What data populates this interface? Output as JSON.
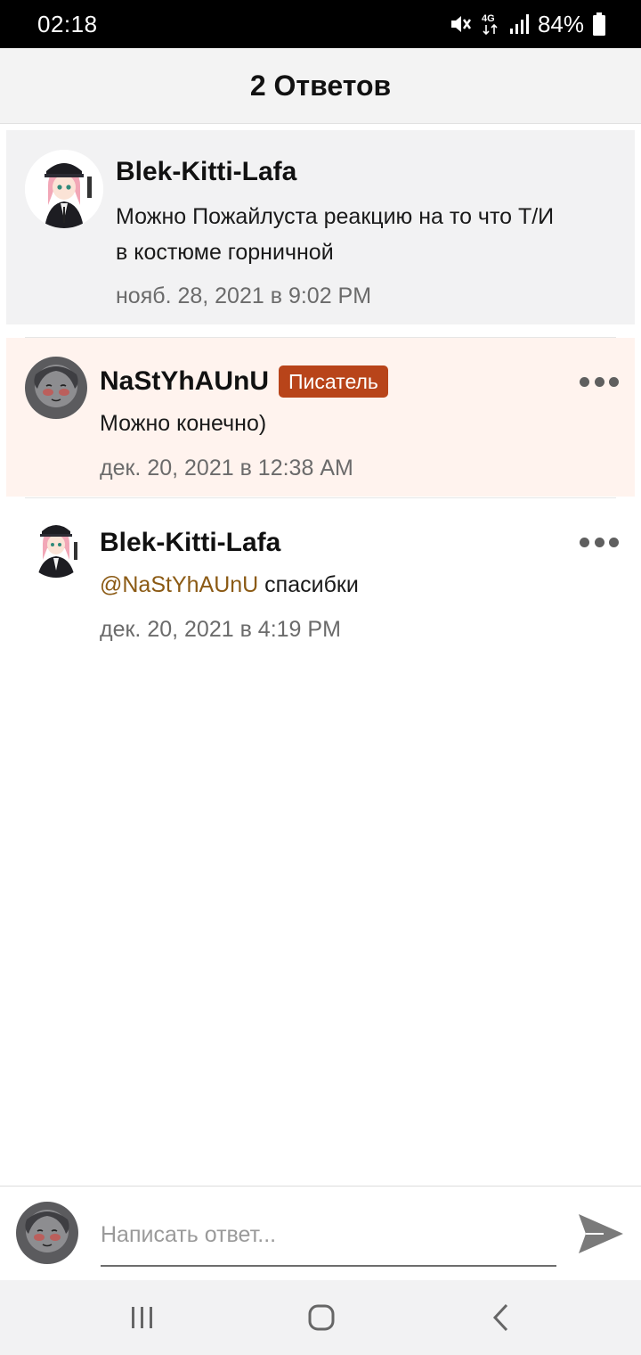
{
  "status_bar": {
    "time": "02:18",
    "battery": "84%",
    "network": "4G",
    "icons": [
      "mute-icon",
      "network-4g-icon",
      "signal-icon",
      "battery-icon"
    ]
  },
  "header": {
    "title": "2 Ответов"
  },
  "comments": [
    {
      "author": "Blek-Kitti-Lafa",
      "text_lines": [
        "Можно Пожайлуста реакцию на то что Т/И",
        "в костюме горничной"
      ],
      "time": "нояб. 28, 2021 в 9:02 PM"
    },
    {
      "author": "NaStYhAUnU",
      "badge": "Писатель",
      "text": "Можно конечно)",
      "time": "дек. 20, 2021 в 12:38 AM"
    },
    {
      "author": "Blek-Kitti-Lafa",
      "mention": "@NaStYhAUnU",
      "text": " спасибки",
      "time": "дек. 20, 2021 в 4:19 PM"
    }
  ],
  "reply": {
    "placeholder": "Написать ответ..."
  },
  "colors": {
    "badge": "#b8441a",
    "mention": "#8b5a14",
    "highlight_bg": "#fff3ee",
    "header_bg": "#f3f3f3"
  }
}
